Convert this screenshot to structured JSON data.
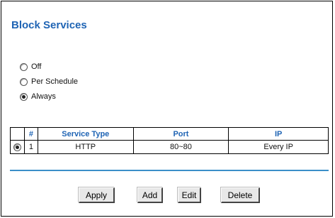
{
  "title": "Block Services",
  "radios": [
    {
      "label": "Off",
      "checked": false
    },
    {
      "label": "Per Schedule",
      "checked": false
    },
    {
      "label": "Always",
      "checked": true
    }
  ],
  "table": {
    "headers": [
      "",
      "#",
      "Service Type",
      "Port",
      "IP"
    ],
    "rows": [
      {
        "selected": true,
        "num": "1",
        "service_type": "HTTP",
        "port": "80~80",
        "ip": "Every IP"
      }
    ]
  },
  "buttons": {
    "apply": "Apply",
    "add": "Add",
    "edit": "Edit",
    "delete": "Delete"
  },
  "colors": {
    "accent": "#1f64b4",
    "separator": "#3b8fc8"
  }
}
